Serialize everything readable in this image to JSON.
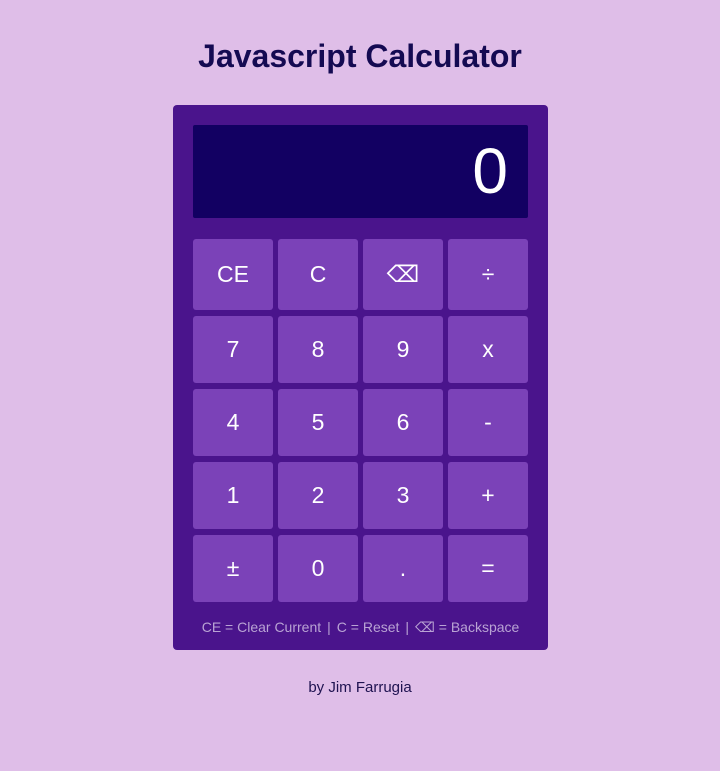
{
  "page": {
    "title": "Javascript Calculator",
    "byline": "by Jim Farrugia"
  },
  "display": {
    "value": "0"
  },
  "keys": {
    "ce": "CE",
    "c": "C",
    "backspace": "⌫",
    "divide": "÷",
    "seven": "7",
    "eight": "8",
    "nine": "9",
    "multiply": "x",
    "four": "4",
    "five": "5",
    "six": "6",
    "minus": "-",
    "one": "1",
    "two": "2",
    "three": "3",
    "plus": "+",
    "negate": "±",
    "zero": "0",
    "decimal": ".",
    "equals": "="
  },
  "legend": {
    "ce": "CE = Clear Current",
    "c": "C = Reset",
    "backspace": "⌫ = Backspace",
    "separator": "|"
  },
  "colors": {
    "page_background": "#dfbee8",
    "calculator_body": "#4a148c",
    "display_background": "#120062",
    "key_background": "#7b42b8",
    "key_text": "#ffffff",
    "title_text": "#140a52",
    "legend_text": "#b9a3d4"
  }
}
